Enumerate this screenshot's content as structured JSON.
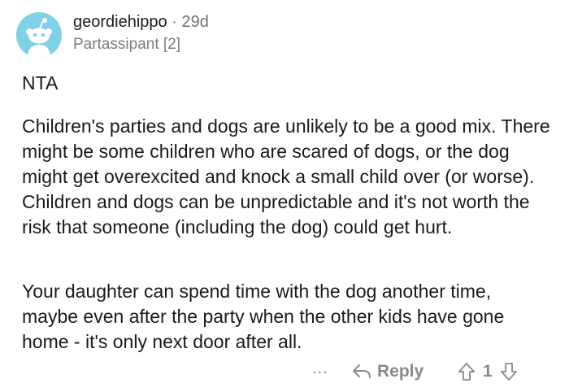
{
  "comment": {
    "author": "geordiehippo",
    "separator": "·",
    "age": "29d",
    "flair": "Partassipant [2]",
    "paragraphs": [
      "NTA",
      "Children's parties and dogs are unlikely to be a good mix. There might be some children who are scared of dogs, or the dog might get overexcited and knock a small child over (or worse). Children and dogs can be unpredictable and it's not worth the risk that someone (including the dog) could get hurt.",
      "Your daughter can spend time with the dog another time, maybe even after the party when the other kids have gone home - it's only next door after all."
    ]
  },
  "actions": {
    "more_label": "...",
    "reply_label": "Reply",
    "vote_count": "1"
  },
  "icons": {
    "avatar": "snoo-avatar-icon",
    "reply": "reply-arrow-icon",
    "upvote": "upvote-arrow-icon",
    "downvote": "downvote-arrow-icon"
  },
  "colors": {
    "avatar_bg": "#7fd1e5",
    "meta_gray": "#878a8c",
    "text": "#1a1a1b"
  }
}
